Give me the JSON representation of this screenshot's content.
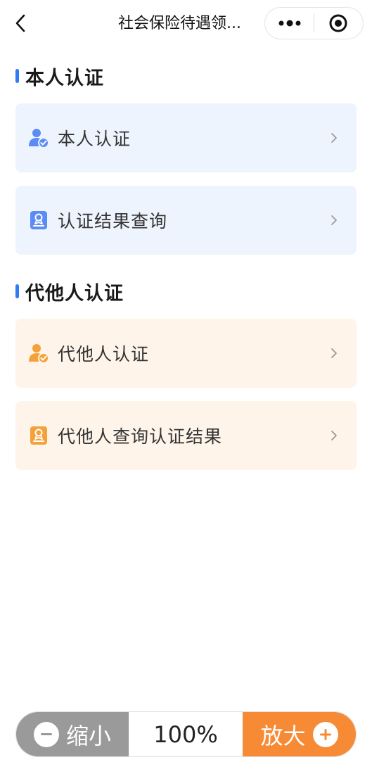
{
  "navbar": {
    "title": "社会保险待遇领...",
    "back_icon": "chevron-left-icon",
    "more_icon": "more-dots-icon",
    "close_icon": "target-circle-icon"
  },
  "sections": [
    {
      "title": "本人认证",
      "accent": "#2f7cf6",
      "items": [
        {
          "label": "本人认证",
          "icon": "user-check-icon"
        },
        {
          "label": "认证结果查询",
          "icon": "certificate-icon"
        }
      ]
    },
    {
      "title": "代他人认证",
      "accent": "#2f7cf6",
      "items": [
        {
          "label": "代他人认证",
          "icon": "user-check-icon"
        },
        {
          "label": "代他人查询认证结果",
          "icon": "certificate-icon"
        }
      ]
    }
  ],
  "zoom": {
    "out_label": "缩小",
    "value": "100%",
    "in_label": "放大"
  },
  "colors": {
    "blue_icon": "#5b8cf5",
    "orange_icon": "#f4a13a",
    "blue_card": "#eef4fd",
    "orange_card": "#fef4ea",
    "zoom_out_bg": "#9a9a9a",
    "zoom_in_bg": "#f78a35"
  }
}
